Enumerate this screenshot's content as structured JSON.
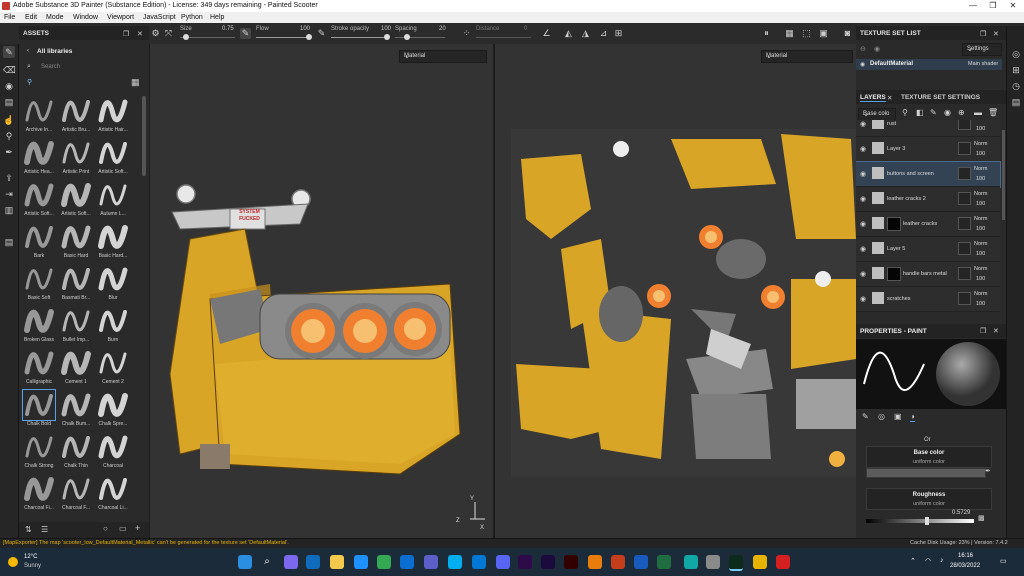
{
  "window": {
    "title": "Adobe Substance 3D Painter (Substance Edition) - License: 349 days remaining - Painted Scooter",
    "controls": [
      "—",
      "❐",
      "✕"
    ]
  },
  "menu": [
    "File",
    "Edit",
    "Mode",
    "Window",
    "Viewport",
    "JavaScript",
    "Python",
    "Help"
  ],
  "toolbar": {
    "size_label": "Size",
    "size_value": "0.75",
    "flow_label": "Flow",
    "flow_value": "100",
    "stroke_label": "Stroke opacity",
    "stroke_value": "100",
    "spacing_label": "Spacing",
    "spacing_value": "20",
    "distance_label": "Distance",
    "distance_value": "0"
  },
  "assets": {
    "header": "ASSETS",
    "library": "All libraries",
    "search_placeholder": "Search",
    "brushes": [
      "Archive In...",
      "Artistic Bru...",
      "Artistic Hair...",
      "Artistic Hea...",
      "Artistic Print",
      "Artistic Soft...",
      "Artistic Soft...",
      "Artistic Soft...",
      "Autumn L...",
      "Bark",
      "Basic Hard",
      "Basic Hard...",
      "Basic Soft",
      "Basmati Br...",
      "Blur",
      "Broken Glass",
      "Bullet Imp...",
      "Burn",
      "Calligraphic",
      "Cement 1",
      "Cement 2",
      "Chalk Bold",
      "Chalk Bum...",
      "Chalk Spre...",
      "Chalk Strong",
      "Chalk Thin",
      "Charcoal",
      "Charcoal Fi...",
      "Charcoal F...",
      "Charcoal Li..."
    ],
    "selected_index": 21
  },
  "viewport3d": {
    "mode": "Material",
    "sign_text": "SYSTEM FUCKED"
  },
  "viewport2d": {
    "mode": "Material"
  },
  "texture_set_list": {
    "header": "TEXTURE SET LIST",
    "settings": "Settings",
    "item": "DefaultMaterial",
    "shader": "Main shader"
  },
  "layers": {
    "tab_layers": "LAYERS",
    "tab_tss": "TEXTURE SET SETTINGS",
    "channel": "Base colo",
    "items": [
      {
        "name": "rust",
        "blend": "",
        "opacity": "100",
        "mask": false
      },
      {
        "name": "Layer 3",
        "blend": "Norm",
        "opacity": "100",
        "mask": false
      },
      {
        "name": "buttons and screen",
        "blend": "Norm",
        "opacity": "100",
        "mask": false
      },
      {
        "name": "leather cracks 2",
        "blend": "Norm",
        "opacity": "100",
        "mask": false
      },
      {
        "name": "leather cracks",
        "blend": "Norm",
        "opacity": "100",
        "mask": true
      },
      {
        "name": "Layer 5",
        "blend": "Norm",
        "opacity": "100",
        "mask": false
      },
      {
        "name": "handle bars metal",
        "blend": "Norm",
        "opacity": "100",
        "mask": true
      },
      {
        "name": "scratches",
        "blend": "Norm",
        "opacity": "100",
        "mask": false
      }
    ]
  },
  "properties": {
    "header": "PROPERTIES - PAINT",
    "channel_label": "Or",
    "base_color": {
      "label": "Base color",
      "sub": "uniform color"
    },
    "roughness": {
      "label": "Roughness",
      "sub": "uniform color",
      "value": "0.5729"
    }
  },
  "status": {
    "message": "[MapExporter] The map 'scooter_low_DefaultMaterial_Metallic' can't be generated for the texture set 'DefaultMaterial'.",
    "right": "Cache Disk Usage:   23%  |  Version: 7.4.2"
  },
  "taskbar": {
    "weather_temp": "12°C",
    "weather_desc": "Sunny",
    "time": "16:16",
    "date": "28/03/2022"
  },
  "colors": {
    "accent": "#5aa0e6",
    "status_text": "#e6b400",
    "scooter_yellow": "#d9a526"
  }
}
